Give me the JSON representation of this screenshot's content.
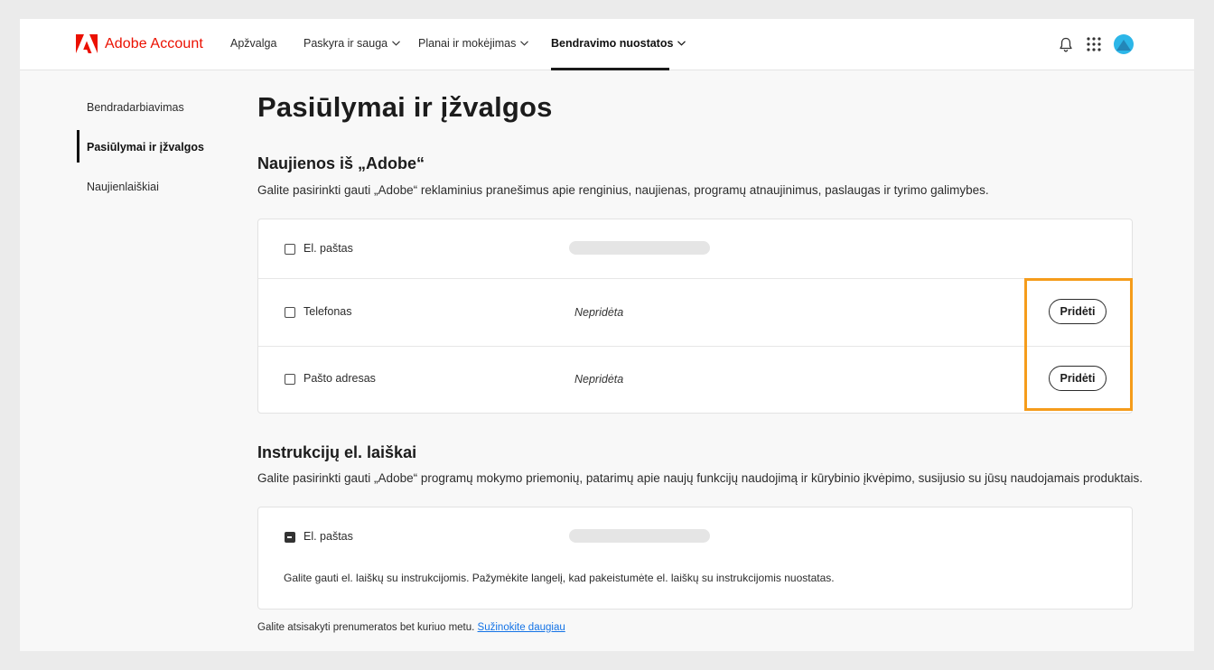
{
  "header": {
    "logo_text": "Adobe Account",
    "nav": [
      {
        "label": "Apžvalga"
      },
      {
        "label": "Paskyra ir sauga"
      },
      {
        "label": "Planai ir mokėjimas"
      },
      {
        "label": "Bendravimo nuostatos"
      }
    ]
  },
  "sidebar": {
    "items": [
      {
        "label": "Bendradarbiavimas"
      },
      {
        "label": "Pasiūlymai ir įžvalgos"
      },
      {
        "label": "Naujienlaiškiai"
      }
    ]
  },
  "page": {
    "title": "Pasiūlymai ir įžvalgos"
  },
  "news_section": {
    "title": "Naujienos iš „Adobe“",
    "description": "Galite pasirinkti gauti „Adobe“ reklaminius pranešimus apie renginius, naujienas, programų atnaujinimus, paslaugas ir tyrimo galimybes.",
    "rows": [
      {
        "label": "El. paštas"
      },
      {
        "label": "Telefonas",
        "value": "Nepridėta",
        "button": "Pridėti"
      },
      {
        "label": "Pašto adresas",
        "value": "Nepridėta",
        "button": "Pridėti"
      }
    ]
  },
  "instructions_section": {
    "title": "Instrukcijų el. laiškai",
    "description": "Galite pasirinkti gauti „Adobe“ programų mokymo priemonių, patarimų apie naujų funkcijų naudojimą ir kūrybinio įkvėpimo, susijusio su jūsų naudojamais produktais.",
    "row": {
      "label": "El. paštas"
    },
    "note": "Galite gauti el. laiškų su instrukcijomis. Pažymėkite langelį, kad pakeistumėte el. laiškų su instrukcijomis nuostatas."
  },
  "footer": {
    "text": "Galite atsisakyti prenumeratos bet kuriuo metu.",
    "link": "Sužinokite daugiau"
  },
  "colors": {
    "brand": "#eb1000",
    "highlight": "#f59c1b",
    "link": "#1473e6",
    "avatar": "#2cb6e8"
  }
}
